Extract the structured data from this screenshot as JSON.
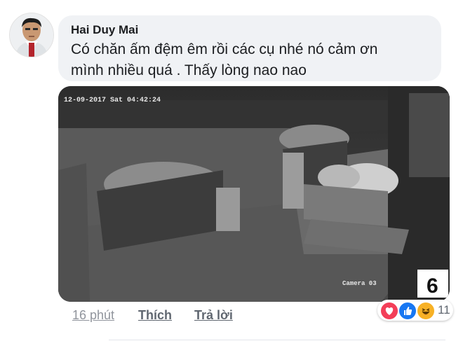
{
  "comment": {
    "author": "Hai Duy Mai",
    "text_line1": "Có chăn ấm đệm êm rồi các cụ nhé nó cảm ơn",
    "text_line2": "mình nhiều quá . Thấy lòng nao nao"
  },
  "photo": {
    "timestamp": "12-09-2017 Sat 04:42:24",
    "camera_label": "Camera 03",
    "overlay_number": "6"
  },
  "actions": {
    "time": "16 phút",
    "like": "Thích",
    "reply": "Trả lời"
  },
  "reactions": {
    "icons": [
      "heart-icon",
      "thumbs-up-icon",
      "haha-icon"
    ],
    "count": "11",
    "colors": {
      "love": "#f33e58",
      "like": "#1877f2",
      "haha": "#f7b125"
    }
  }
}
